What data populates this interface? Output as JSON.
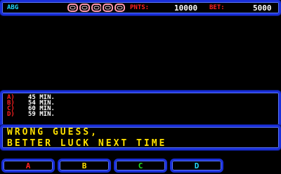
{
  "header": {
    "player": "ABG",
    "pnts_label": "PNTS:",
    "pnts_value": "10000",
    "bet_label": "BET:",
    "bet_value": "5000",
    "lives_icon": "chain-link-icon",
    "lives_count": 5
  },
  "answers": [
    {
      "letter": "A)",
      "text": "45 MIN."
    },
    {
      "letter": "B)",
      "text": "54 MIN."
    },
    {
      "letter": "C)",
      "text": "60 MIN."
    },
    {
      "letter": "D)",
      "text": "59 MIN."
    }
  ],
  "message": {
    "line1": "WRONG GUESS,",
    "line2": "BETTER LUCK NEXT TIME"
  },
  "buttons": [
    {
      "label": "A",
      "color": "#ff2020"
    },
    {
      "label": "B",
      "color": "#ffe000"
    },
    {
      "label": "C",
      "color": "#20e020"
    },
    {
      "label": "D",
      "color": "#20d8ff"
    }
  ],
  "colors": {
    "border": "#1a2fd8",
    "answer_letter": "#ff2020",
    "answer_text": "#ffffff",
    "message": "#ffe000",
    "label": "#ff2020",
    "value": "#ffffff",
    "player": "#20d8ff"
  }
}
